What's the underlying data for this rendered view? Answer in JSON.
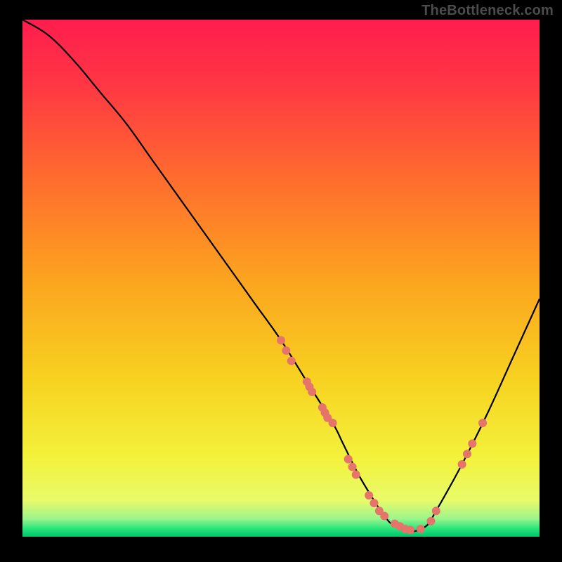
{
  "watermark": "TheBottleneck.com",
  "chart_data": {
    "type": "line",
    "title": "",
    "xlabel": "",
    "ylabel": "",
    "xlim": [
      0,
      100
    ],
    "ylim": [
      0,
      100
    ],
    "curve": {
      "name": "bottleneck-curve",
      "x": [
        0,
        5,
        10,
        15,
        20,
        25,
        30,
        35,
        40,
        45,
        50,
        55,
        60,
        62,
        65,
        68,
        70,
        72,
        75,
        78,
        80,
        85,
        90,
        95,
        100
      ],
      "y": [
        100,
        97,
        92,
        86,
        80,
        73,
        66,
        59,
        52,
        45,
        38,
        30,
        22,
        18,
        12,
        7,
        4,
        2,
        1,
        2,
        5,
        14,
        24,
        35,
        46
      ]
    },
    "scatter": {
      "name": "sample-points",
      "color": "#e5746b",
      "radius": 6,
      "points": [
        {
          "x": 50,
          "y": 38
        },
        {
          "x": 51,
          "y": 36
        },
        {
          "x": 52,
          "y": 34
        },
        {
          "x": 55,
          "y": 30
        },
        {
          "x": 55.5,
          "y": 29
        },
        {
          "x": 56,
          "y": 28
        },
        {
          "x": 58,
          "y": 25
        },
        {
          "x": 58.5,
          "y": 24
        },
        {
          "x": 59,
          "y": 23
        },
        {
          "x": 60,
          "y": 22
        },
        {
          "x": 63,
          "y": 15
        },
        {
          "x": 63.8,
          "y": 13.5
        },
        {
          "x": 64.5,
          "y": 12
        },
        {
          "x": 67,
          "y": 8
        },
        {
          "x": 68,
          "y": 6.5
        },
        {
          "x": 69,
          "y": 5
        },
        {
          "x": 70,
          "y": 4
        },
        {
          "x": 72,
          "y": 2.5
        },
        {
          "x": 73,
          "y": 2
        },
        {
          "x": 74,
          "y": 1.5
        },
        {
          "x": 75,
          "y": 1.3
        },
        {
          "x": 77,
          "y": 1.5
        },
        {
          "x": 79,
          "y": 3
        },
        {
          "x": 80,
          "y": 5
        },
        {
          "x": 85,
          "y": 14
        },
        {
          "x": 86,
          "y": 16
        },
        {
          "x": 87,
          "y": 18
        },
        {
          "x": 89,
          "y": 22
        }
      ]
    },
    "gradient_stops": [
      {
        "offset": 0.0,
        "color": "#ff1d4e"
      },
      {
        "offset": 0.12,
        "color": "#ff3545"
      },
      {
        "offset": 0.3,
        "color": "#ff6a2f"
      },
      {
        "offset": 0.5,
        "color": "#fca31f"
      },
      {
        "offset": 0.7,
        "color": "#f7d321"
      },
      {
        "offset": 0.85,
        "color": "#f3f23c"
      },
      {
        "offset": 0.93,
        "color": "#e8fb6a"
      },
      {
        "offset": 0.965,
        "color": "#9cf58c"
      },
      {
        "offset": 0.985,
        "color": "#23e57a"
      },
      {
        "offset": 1.0,
        "color": "#00c46a"
      }
    ]
  }
}
